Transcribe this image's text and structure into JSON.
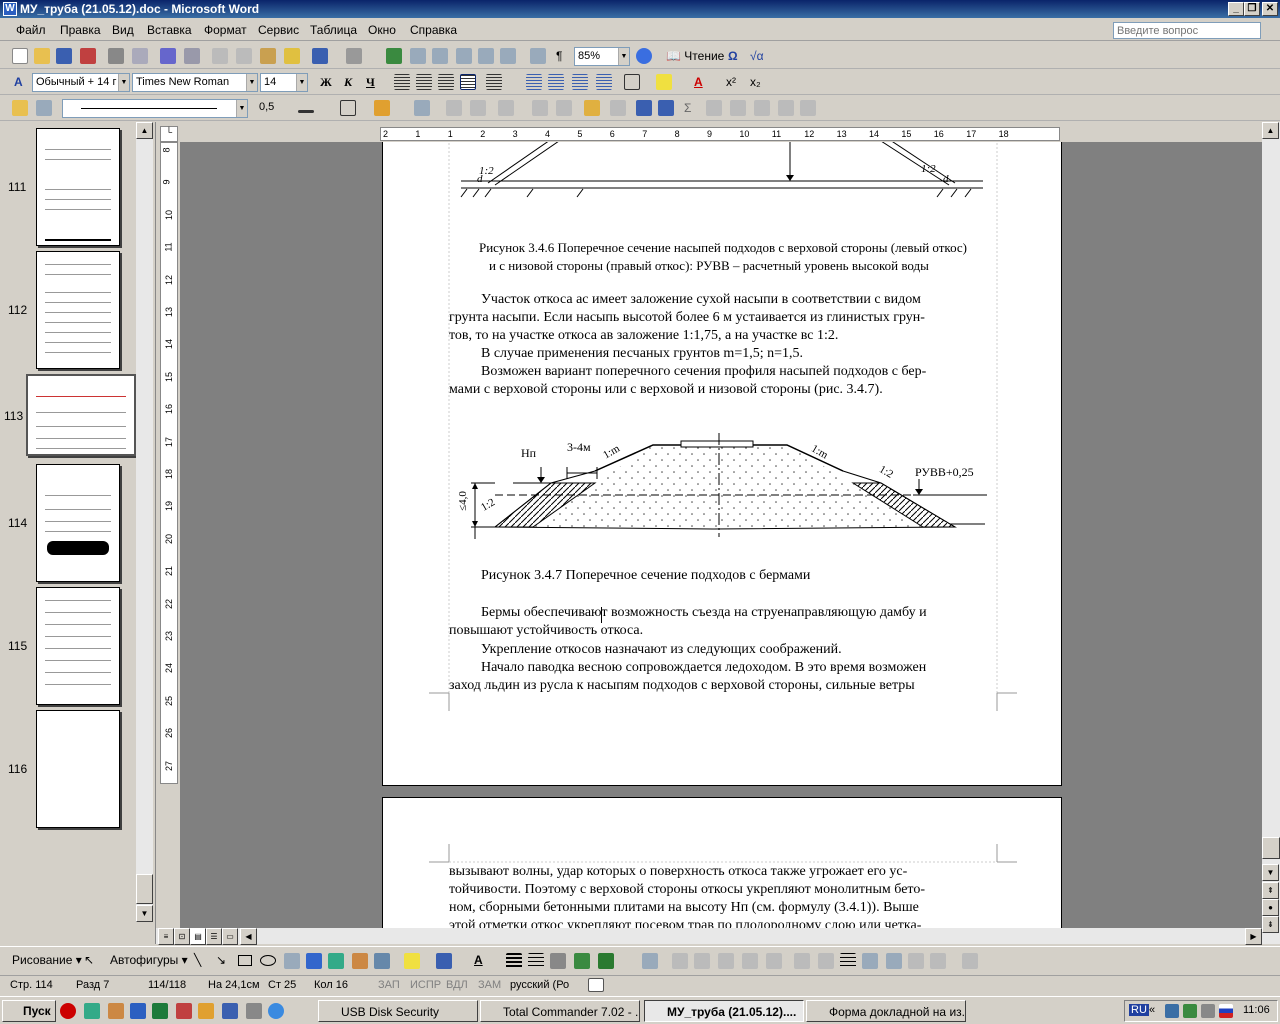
{
  "window": {
    "title": "МУ_труба (21.05.12).doc - Microsoft Word"
  },
  "menu": {
    "items": [
      "Файл",
      "Правка",
      "Вид",
      "Вставка",
      "Формат",
      "Сервис",
      "Таблица",
      "Окно",
      "Справка"
    ],
    "help_placeholder": "Введите вопрос"
  },
  "toolbar": {
    "zoom": "85%",
    "reading_label": "Чтение",
    "style": "Обычный + 14 г",
    "font": "Times New Roman",
    "size": "14",
    "bold": "Ж",
    "italic": "К",
    "underline": "Ч",
    "line_weight": "0,5"
  },
  "thumbnails": [
    {
      "page": "111"
    },
    {
      "page": "112"
    },
    {
      "page": "113",
      "selected": true
    },
    {
      "page": "114"
    },
    {
      "page": "115"
    },
    {
      "page": "116"
    }
  ],
  "ruler": {
    "h_labels": [
      "2",
      "1",
      "1",
      "2",
      "3",
      "4",
      "5",
      "6",
      "7",
      "8",
      "9",
      "10",
      "11",
      "12",
      "13",
      "14",
      "15",
      "16",
      "17",
      "18"
    ],
    "v_labels": [
      "8",
      "9",
      "10",
      "11",
      "12",
      "13",
      "14",
      "15",
      "16",
      "17",
      "18",
      "19",
      "20",
      "21",
      "22",
      "23",
      "24",
      "25",
      "26",
      "27"
    ]
  },
  "document": {
    "fig1_caption_1": "Рисунок 3.4.6 Поперечное сечение насыпей подходов с верховой стороны (левый откос)",
    "fig1_caption_2": "и с низовой стороны (правый откос): РУВВ – расчетный уровень высокой воды",
    "para1_l1": "Участок откоса ас имеет заложение сухой насыпи в соответствии с видом",
    "para1_l2": "грунта насыпи. Если насыпь высотой более 6 м устаивается из глинистых грун-",
    "para1_l3": "тов, то на участке откоса ав заложение 1:1,75, а на участке вс 1:2.",
    "para2": "В случае применения песчаных грунтов m=1,5; n=1,5.",
    "para3_l1": "Возможен вариант поперечного сечения профиля насыпей подходов с бер-",
    "para3_l2": "мами с верховой стороны или с верховой и низовой стороны (рис. 3.4.7).",
    "fig2": {
      "hn": "Нп",
      "berm": "3-4м",
      "slope_1m_left": "1:m",
      "slope_1m_right": "1:m",
      "slope_12_left": "1:2",
      "slope_12_right": "1:2",
      "ruvv": "РУВВ+0,25",
      "height": "≤4,0"
    },
    "fig1": {
      "slope_left": "1:2",
      "slope_right": "1:2",
      "mark_left": "d",
      "mark_right": "d"
    },
    "fig2_caption": "Рисунок 3.4.7 Поперечное сечение подходов с бермами",
    "para4_l1": "Бермы обеспечивают возможность съезда на струенаправляющую дамбу и",
    "para4_l2": "повышают устойчивость откоса.",
    "para5": "Укрепление откосов назначают из следующих соображений.",
    "para6_l1": "Начало паводка весною сопровождается ледоходом. В это время возможен",
    "para6_l2": "заход льдин из русла к насыпям подходов с верховой стороны, сильные ветры",
    "page2_l1": "вызывают волны, удар которых о поверхность откоса также угрожает его ус-",
    "page2_l2": "тойчивости. Поэтому с верховой стороны откосы укрепляют монолитным бето-",
    "page2_l3": "ном, сборными бетонными плитами на высоту Нп (см. формулу (3.4.1)). Выше",
    "page2_l4": "этой отметки откос укрепляют посевом трав по плодородному слою или четка-"
  },
  "drawing_toolbar": {
    "draw": "Рисование ▾",
    "autoshapes": "Автофигуры ▾"
  },
  "status": {
    "page": "Стр. 114",
    "section": "Разд 7",
    "pages": "114/118",
    "at": "На 24,1см",
    "line": "Ст 25",
    "col": "Кол 16",
    "rec": "ЗАП",
    "trk": "ИСПР",
    "ext": "ВДЛ",
    "ovr": "ЗАМ",
    "lang": "русский (Ро"
  },
  "taskbar": {
    "start": "Пуск",
    "tasks": [
      "USB Disk Security",
      "Total Commander 7.02 - ...",
      "МУ_труба (21.05.12)....",
      "Форма докладной на из..."
    ],
    "lang": "RU",
    "time": "11:06"
  },
  "colors": {
    "title_start": "#0a246a",
    "title_end": "#3a6ea5",
    "chrome": "#d4d0c8",
    "doc_bg": "#808080"
  }
}
